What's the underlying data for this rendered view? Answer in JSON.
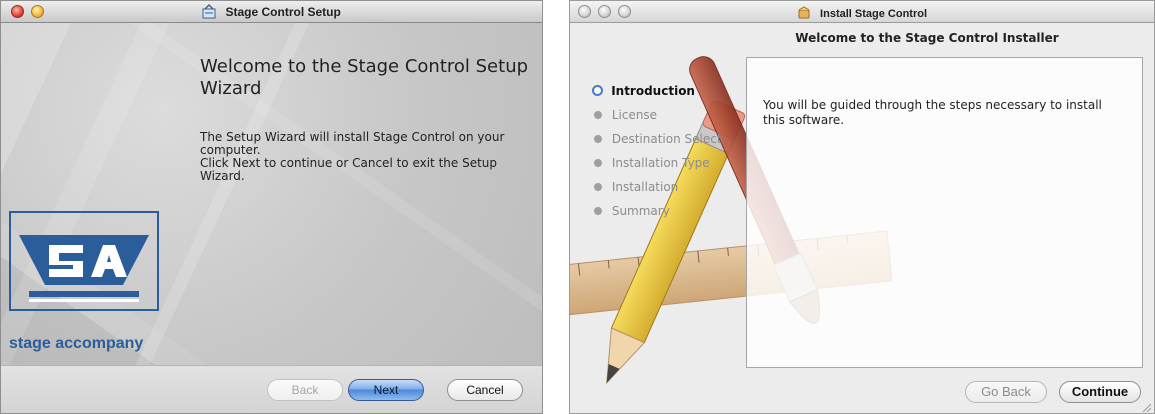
{
  "left_window": {
    "title": "Stage Control Setup",
    "heading": "Welcome to the Stage Control Setup Wizard",
    "body_lines": [
      "The Setup Wizard will install Stage Control on your computer.",
      "Click Next to continue or Cancel to exit the Setup Wizard."
    ],
    "logo_text": "stage accompany",
    "buttons": {
      "back": "Back",
      "next": "Next",
      "cancel": "Cancel"
    },
    "colors": {
      "brand_blue": "#2b5d9a"
    }
  },
  "right_window": {
    "title": "Install Stage Control",
    "heading": "Welcome to the Stage Control Installer",
    "steps": [
      {
        "label": "Introduction",
        "active": true
      },
      {
        "label": "License",
        "active": false
      },
      {
        "label": "Destination Select",
        "active": false
      },
      {
        "label": "Installation Type",
        "active": false
      },
      {
        "label": "Installation",
        "active": false
      },
      {
        "label": "Summary",
        "active": false
      }
    ],
    "panel_text": "You will be guided through the steps necessary to install this software.",
    "buttons": {
      "go_back": "Go Back",
      "continue": "Continue"
    },
    "colors": {
      "step_active": "#4b78c6"
    }
  }
}
